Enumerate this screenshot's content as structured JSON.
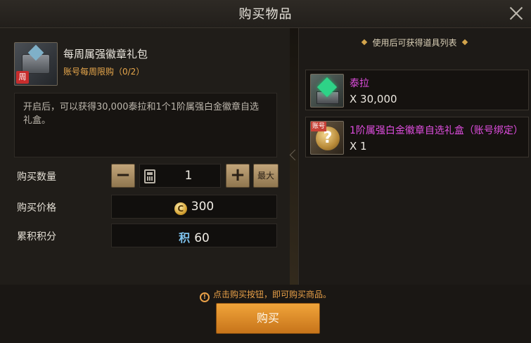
{
  "dialog": {
    "title": "购买物品"
  },
  "package": {
    "name": "每周属强徽章礼包",
    "limit": "账号每周限购（0/2）",
    "weekly_tag": "周",
    "description": "开启后，可以获得30,000泰拉和1个1阶属强白金徽章自选礼盒。"
  },
  "form": {
    "quantity_label": "购买数量",
    "quantity_value": "1",
    "minus_label": "−",
    "plus_label": "+",
    "max_label": "最大",
    "price_label": "购买价格",
    "price_value": "300",
    "price_icon": "C",
    "points_label": "累积积分",
    "points_icon": "积",
    "points_value": "60"
  },
  "rewards": {
    "header": "使用后可获得道具列表",
    "items": [
      {
        "name": "泰拉",
        "qty": "X 30,000",
        "icon": "tera-crystal-icon"
      },
      {
        "name": "1阶属强白金徽章自选礼盒（账号绑定）",
        "qty": "X 1",
        "icon": "badge-box-icon",
        "tag": "账号",
        "glyph": "?"
      }
    ]
  },
  "footer": {
    "notice": "点击购买按钮，即可购买商品。",
    "warn_glyph": "!",
    "buy_label": "购买"
  },
  "colors": {
    "accent": "#e8a048",
    "reward_name": "#df4ddf",
    "button": "#f0a43a"
  }
}
